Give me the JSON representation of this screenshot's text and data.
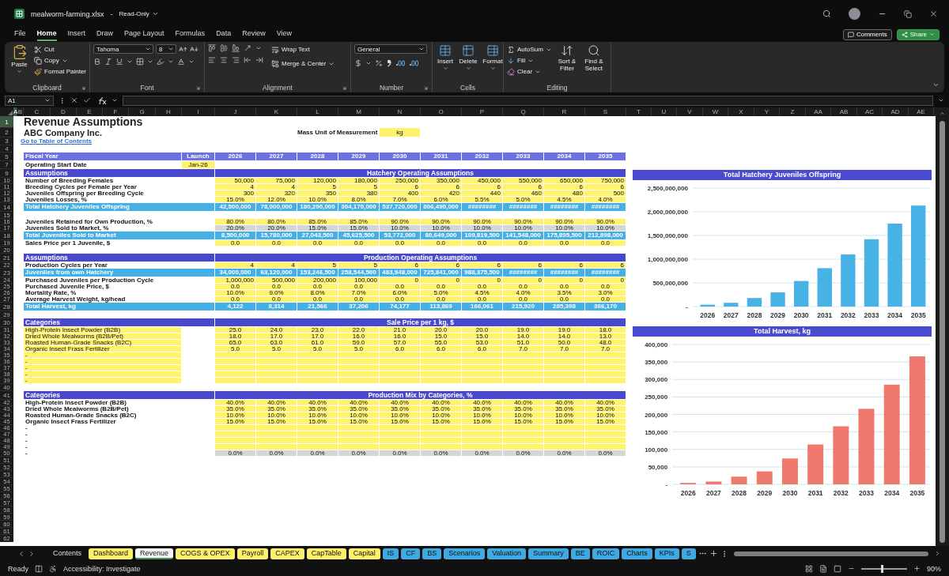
{
  "titlebar": {
    "filename": "mealworm-farming.xlsx",
    "separator": "-",
    "mode": "Read-Only"
  },
  "menu": [
    {
      "label": "File",
      "selected": false
    },
    {
      "label": "Home",
      "selected": true
    },
    {
      "label": "Insert",
      "selected": false
    },
    {
      "label": "Draw",
      "selected": false
    },
    {
      "label": "Page Layout",
      "selected": false
    },
    {
      "label": "Formulas",
      "selected": false
    },
    {
      "label": "Data",
      "selected": false
    },
    {
      "label": "Review",
      "selected": false
    },
    {
      "label": "View",
      "selected": false
    }
  ],
  "actions": {
    "comments": "Comments",
    "share": "Share"
  },
  "ribbon": {
    "clipboard": {
      "paste": "Paste",
      "cut": "Cut",
      "copy": "Copy",
      "format_painter": "Format Painter",
      "label": "Clipboard"
    },
    "font": {
      "face": "Tahoma",
      "size": "8",
      "label": "Font"
    },
    "alignment": {
      "wrap": "Wrap Text",
      "merge": "Merge & Center",
      "label": "Alignment"
    },
    "number": {
      "format": "General",
      "label": "Number"
    },
    "cells": {
      "insert": "Insert",
      "delete": "Delete",
      "format": "Format",
      "label": "Cells"
    },
    "editing": {
      "autosum": "AutoSum",
      "fill": "Fill",
      "clear": "Clear",
      "sort": "Sort & Filter",
      "find": "Find & Select",
      "label": "Editing"
    }
  },
  "formula_bar": {
    "name_box": "A1"
  },
  "columns": [
    {
      "label": "A",
      "selected": true
    },
    {
      "label": "B",
      "selected": false
    },
    {
      "label": "C",
      "selected": false
    },
    {
      "label": "D",
      "selected": false
    },
    {
      "label": "E",
      "selected": false
    },
    {
      "label": "F",
      "selected": false
    },
    {
      "label": "G",
      "selected": false
    },
    {
      "label": "H",
      "selected": false
    },
    {
      "label": "I",
      "selected": false
    },
    {
      "label": "J",
      "selected": false
    },
    {
      "label": "K",
      "selected": false
    },
    {
      "label": "L",
      "selected": false
    },
    {
      "label": "M",
      "selected": false
    },
    {
      "label": "N",
      "selected": false
    },
    {
      "label": "O",
      "selected": false
    },
    {
      "label": "P",
      "selected": false
    },
    {
      "label": "Q",
      "selected": false
    },
    {
      "label": "R",
      "selected": false
    },
    {
      "label": "S",
      "selected": false
    },
    {
      "label": "T",
      "selected": false
    },
    {
      "label": "U",
      "selected": false
    },
    {
      "label": "V",
      "selected": false
    },
    {
      "label": "W",
      "selected": false
    },
    {
      "label": "X",
      "selected": false
    },
    {
      "label": "Y",
      "selected": false
    },
    {
      "label": "Z",
      "selected": false
    },
    {
      "label": "AA",
      "selected": false
    },
    {
      "label": "AB",
      "selected": false
    },
    {
      "label": "AC",
      "selected": false
    },
    {
      "label": "AD",
      "selected": false
    },
    {
      "label": "AE",
      "selected": false
    }
  ],
  "sheet": {
    "rows": [
      {
        "n": "1",
        "kind": "title",
        "selected": true,
        "label": "Revenue Assumptions"
      },
      {
        "n": "2",
        "kind": "subtitle",
        "selected": false,
        "label": "ABC Company Inc.",
        "note": "Mass Unit of Measurement",
        "unit": "kg"
      },
      {
        "n": "3",
        "kind": "link",
        "selected": false,
        "label": "Go to Table of Contents"
      },
      {
        "n": "4",
        "kind": "blank",
        "selected": false
      },
      {
        "n": "5",
        "kind": "header",
        "selected": false,
        "label": "Fiscal Year",
        "launch": "Launch",
        "values": [
          "2026",
          "2027",
          "2028",
          "2029",
          "2030",
          "2031",
          "2032",
          "2033",
          "2034",
          "2035"
        ]
      },
      {
        "n": "7",
        "kind": "date",
        "selected": false,
        "label": "Operating Start Date",
        "launch": "Jan-26"
      },
      {
        "n": "9",
        "kind": "section",
        "selected": false,
        "label": "Assumptions",
        "title": "Hatchery Operating Assumptions"
      },
      {
        "n": "10",
        "kind": "input",
        "selected": false,
        "label": "Number of Breeding Females",
        "values": [
          "50,000",
          "75,000",
          "120,000",
          "180,000",
          "250,000",
          "350,000",
          "450,000",
          "550,000",
          "650,000",
          "750,000"
        ]
      },
      {
        "n": "11",
        "kind": "input",
        "selected": false,
        "label": "Breeding Cycles per Female per Year",
        "values": [
          "4",
          "4",
          "5",
          "5",
          "6",
          "6",
          "6",
          "6",
          "6",
          "6"
        ]
      },
      {
        "n": "12",
        "kind": "input",
        "selected": false,
        "label": "Juveniles Offspring per Breeding Cycle",
        "values": [
          "300",
          "320",
          "350",
          "380",
          "400",
          "420",
          "440",
          "460",
          "480",
          "500"
        ]
      },
      {
        "n": "13",
        "kind": "rate",
        "selected": false,
        "label": "Juveniles Losses, %",
        "values": [
          "15.0%",
          "12.0%",
          "10.0%",
          "8.0%",
          "7.0%",
          "6.0%",
          "5.5%",
          "5.0%",
          "4.5%",
          "4.0%"
        ]
      },
      {
        "n": "14",
        "kind": "total",
        "selected": false,
        "label": "Total Hatchery Juveniles Offspring",
        "values": [
          "42,500,000",
          "78,000,000",
          "180,290,000",
          "304,170,000",
          "537,720,000",
          "806,490,000",
          "########",
          "########",
          "########",
          "########"
        ]
      },
      {
        "n": "15",
        "kind": "gap",
        "selected": false
      },
      {
        "n": "16",
        "kind": "rate",
        "selected": false,
        "label": "Juveniles Retained for Own Production, %",
        "values": [
          "80.0%",
          "80.0%",
          "85.0%",
          "85.0%",
          "90.0%",
          "90.0%",
          "90.0%",
          "90.0%",
          "90.0%",
          "90.0%"
        ]
      },
      {
        "n": "17",
        "kind": "calc",
        "selected": false,
        "label": "Juveniles Sold to Market, %",
        "values": [
          "20.0%",
          "20.0%",
          "15.0%",
          "15.0%",
          "10.0%",
          "10.0%",
          "10.0%",
          "10.0%",
          "10.0%",
          "10.0%"
        ]
      },
      {
        "n": "18",
        "kind": "total",
        "selected": false,
        "label": "Total Juveniles Sold to Market",
        "values": [
          "8,500,000",
          "15,780,000",
          "27,043,500",
          "45,625,500",
          "53,772,000",
          "80,649,000",
          "109,819,500",
          "141,548,000",
          "175,895,500",
          "212,898,000"
        ]
      },
      {
        "n": "19",
        "kind": "rate",
        "selected": false,
        "label": "Sales Price per 1 Juvenile, $",
        "values": [
          "0.0",
          "0.0",
          "0.0",
          "0.0",
          "0.0",
          "0.0",
          "0.0",
          "0.0",
          "0.0",
          "0.0"
        ]
      },
      {
        "n": "20",
        "kind": "gap",
        "selected": false
      },
      {
        "n": "21",
        "kind": "section",
        "selected": false,
        "label": "Assumptions",
        "title": "Production Operating Assumptions"
      },
      {
        "n": "22",
        "kind": "input",
        "selected": false,
        "label": "Production Cycles per Year",
        "values": [
          "4",
          "4",
          "5",
          "5",
          "6",
          "6",
          "6",
          "6",
          "6",
          "6"
        ]
      },
      {
        "n": "23",
        "kind": "total",
        "selected": false,
        "label": "Juveniles from own Hatchery",
        "values": [
          "34,000,000",
          "63,120,000",
          "153,246,500",
          "258,544,500",
          "483,948,000",
          "725,841,000",
          "988,375,500",
          "########",
          "########",
          "########"
        ]
      },
      {
        "n": "24",
        "kind": "input",
        "selected": false,
        "label": "Purchased Juveniles per Production Cycle",
        "values": [
          "1,000,000",
          "500,000",
          "200,000",
          "100,000",
          "0",
          "0",
          "0",
          "0",
          "0",
          "0"
        ]
      },
      {
        "n": "25",
        "kind": "rate",
        "selected": false,
        "label": "Purchased Juvenile Price, $",
        "values": [
          "0.0",
          "0.0",
          "0.0",
          "0.0",
          "0.0",
          "0.0",
          "0.0",
          "0.0",
          "0.0",
          "0.0"
        ]
      },
      {
        "n": "26",
        "kind": "rate",
        "selected": false,
        "label": "Mortality Rate, %",
        "values": [
          "10.0%",
          "9.0%",
          "8.0%",
          "7.0%",
          "6.0%",
          "5.0%",
          "4.5%",
          "4.0%",
          "3.5%",
          "3.0%"
        ]
      },
      {
        "n": "27",
        "kind": "rate",
        "selected": false,
        "label": "Average Harvest Weight, kg/head",
        "values": [
          "0.0",
          "0.0",
          "0.0",
          "0.0",
          "0.0",
          "0.0",
          "0.0",
          "0.0",
          "0.0",
          "0.0"
        ]
      },
      {
        "n": "28",
        "kind": "total",
        "selected": false,
        "label": "Total Harvest, kg",
        "values": [
          "4,122",
          "8,314",
          "21,566",
          "37,206",
          "74,177",
          "113,869",
          "166,061",
          "215,920",
          "285,398",
          "366,170"
        ]
      },
      {
        "n": "29",
        "kind": "gap",
        "selected": false
      },
      {
        "n": "30",
        "kind": "section",
        "selected": false,
        "label": "Categories",
        "title": "Sale Price per 1 kg, $"
      },
      {
        "n": "31",
        "kind": "category",
        "selected": false,
        "label": "High-Protein Insect Powder (B2B)",
        "values": [
          "25.0",
          "24.0",
          "23.0",
          "22.0",
          "21.0",
          "20.0",
          "20.0",
          "19.0",
          "19.0",
          "18.0"
        ]
      },
      {
        "n": "32",
        "kind": "category",
        "selected": false,
        "label": "Dried Whole Mealworms (B2B/Pet)",
        "values": [
          "18.0",
          "17.0",
          "17.0",
          "16.0",
          "16.0",
          "15.0",
          "15.0",
          "14.0",
          "14.0",
          "13.0"
        ]
      },
      {
        "n": "33",
        "kind": "category",
        "selected": false,
        "label": "Roasted Human-Grade Snacks (B2C)",
        "values": [
          "65.0",
          "63.0",
          "61.0",
          "59.0",
          "57.0",
          "55.0",
          "53.0",
          "51.0",
          "50.0",
          "48.0"
        ]
      },
      {
        "n": "34",
        "kind": "category",
        "selected": false,
        "label": "Organic Insect Frass Fertilizer",
        "values": [
          "5.0",
          "5.0",
          "5.0",
          "5.0",
          "6.0",
          "6.0",
          "6.0",
          "7.0",
          "7.0",
          "7.0"
        ]
      },
      {
        "n": "35",
        "kind": "category",
        "selected": false,
        "label": "-"
      },
      {
        "n": "36",
        "kind": "category",
        "selected": false,
        "label": "-"
      },
      {
        "n": "37",
        "kind": "category",
        "selected": false,
        "label": "-"
      },
      {
        "n": "38",
        "kind": "category",
        "selected": false,
        "label": "-"
      },
      {
        "n": "39",
        "kind": "category",
        "selected": false,
        "label": "-"
      },
      {
        "n": "40",
        "kind": "blank",
        "selected": false
      },
      {
        "n": "41",
        "kind": "section",
        "selected": false,
        "label": "Categories",
        "title": "Production Mix by Categories, %"
      },
      {
        "n": "42",
        "kind": "item",
        "selected": false,
        "label": "High-Protein Insect Powder (B2B)",
        "values": [
          "40.0%",
          "40.0%",
          "40.0%",
          "40.0%",
          "40.0%",
          "40.0%",
          "40.0%",
          "40.0%",
          "40.0%",
          "40.0%"
        ]
      },
      {
        "n": "43",
        "kind": "item",
        "selected": false,
        "label": "Dried Whole Mealworms (B2B/Pet)",
        "values": [
          "35.0%",
          "35.0%",
          "35.0%",
          "35.0%",
          "35.0%",
          "35.0%",
          "35.0%",
          "35.0%",
          "35.0%",
          "35.0%"
        ]
      },
      {
        "n": "44",
        "kind": "item",
        "selected": false,
        "label": "Roasted Human-Grade Snacks (B2C)",
        "values": [
          "10.0%",
          "10.0%",
          "10.0%",
          "10.0%",
          "10.0%",
          "10.0%",
          "10.0%",
          "10.0%",
          "10.0%",
          "10.0%"
        ]
      },
      {
        "n": "45",
        "kind": "item",
        "selected": false,
        "label": "Organic Insect Frass Fertilizer",
        "values": [
          "15.0%",
          "15.0%",
          "15.0%",
          "15.0%",
          "15.0%",
          "15.0%",
          "15.0%",
          "15.0%",
          "15.0%",
          "15.0%"
        ]
      },
      {
        "n": "46",
        "kind": "item",
        "selected": false,
        "label": "-"
      },
      {
        "n": "47",
        "kind": "item",
        "selected": false,
        "label": "-"
      },
      {
        "n": "48",
        "kind": "item",
        "selected": false,
        "label": "-"
      },
      {
        "n": "49",
        "kind": "item",
        "selected": false,
        "label": "-"
      },
      {
        "n": "50",
        "kind": "calc",
        "selected": false,
        "label": "-",
        "values": [
          "0.0%",
          "0.0%",
          "0.0%",
          "0.0%",
          "0.0%",
          "0.0%",
          "0.0%",
          "0.0%",
          "0.0%",
          "0.0%"
        ]
      },
      {
        "n": "51",
        "kind": "blank",
        "selected": false
      },
      {
        "n": "52",
        "kind": "blank",
        "selected": false
      },
      {
        "n": "53",
        "kind": "blank",
        "selected": false
      },
      {
        "n": "54",
        "kind": "blank",
        "selected": false
      },
      {
        "n": "55",
        "kind": "blank",
        "selected": false
      },
      {
        "n": "56",
        "kind": "blank",
        "selected": false
      },
      {
        "n": "57",
        "kind": "blank",
        "selected": false
      },
      {
        "n": "58",
        "kind": "blank",
        "selected": false
      },
      {
        "n": "59",
        "kind": "blank",
        "selected": false
      },
      {
        "n": "60",
        "kind": "blank",
        "selected": false
      },
      {
        "n": "61",
        "kind": "blank",
        "selected": false
      },
      {
        "n": "62",
        "kind": "blank",
        "selected": false
      }
    ]
  },
  "charts": [
    {
      "chart_data": {
        "type": "bar",
        "title": "Total Hatchery Juveniles Offspring",
        "categories": [
          "2026",
          "2027",
          "2028",
          "2029",
          "2030",
          "2031",
          "2032",
          "2033",
          "2034",
          "2035"
        ],
        "series": [
          {
            "color": "#47b2e6",
            "values": [
              40000000,
              80000000,
              180000000,
              300000000,
              540000000,
              810000000,
              1100000000,
              1420000000,
              1750000000,
              2130000000
            ]
          }
        ],
        "ylim": [
          0,
          2500000000
        ],
        "grid": true,
        "yticks": [
          {
            "value": 0,
            "label": "-"
          },
          {
            "value": 500000000,
            "label": "500,000,000"
          },
          {
            "value": 1000000000,
            "label": "1,000,000,000"
          },
          {
            "value": 1500000000,
            "label": "1,500,000,000"
          },
          {
            "value": 2000000000,
            "label": "2,000,000,000"
          },
          {
            "value": 2500000000,
            "label": "2,500,000,000"
          }
        ]
      }
    },
    {
      "chart_data": {
        "type": "bar",
        "title": "Total Harvest, kg",
        "categories": [
          "2026",
          "2027",
          "2028",
          "2029",
          "2030",
          "2031",
          "2032",
          "2033",
          "2034",
          "2035"
        ],
        "series": [
          {
            "color": "#f0786c",
            "values": [
              4000,
              8000,
              22000,
              37000,
              74000,
              114000,
              166000,
              216000,
              285000,
              366000
            ]
          }
        ],
        "ylim": [
          0,
          400000
        ],
        "grid": true,
        "yticks": [
          {
            "value": 0,
            "label": "-"
          },
          {
            "value": 50000,
            "label": "50,000"
          },
          {
            "value": 100000,
            "label": "100,000"
          },
          {
            "value": 150000,
            "label": "150,000"
          },
          {
            "value": 200000,
            "label": "200,000"
          },
          {
            "value": 250000,
            "label": "250,000"
          },
          {
            "value": 300000,
            "label": "300,000"
          },
          {
            "value": 350000,
            "label": "350,000"
          },
          {
            "value": 400000,
            "label": "400,000"
          }
        ]
      }
    }
  ],
  "sheet_tabs": [
    {
      "label": "Contents",
      "selected": false
    },
    {
      "label": "Dashboard",
      "color": "#fff06b",
      "selected": false
    },
    {
      "label": "Revenue",
      "selected": true
    },
    {
      "label": "COGS & OPEX",
      "color": "#fff06b",
      "selected": false
    },
    {
      "label": "Payroll",
      "color": "#fff06b",
      "selected": false
    },
    {
      "label": "CAPEX",
      "color": "#fff06b",
      "selected": false
    },
    {
      "label": "CapTable",
      "color": "#fff06b",
      "selected": false
    },
    {
      "label": "Capital",
      "color": "#fff06b",
      "selected": false
    },
    {
      "label": "IS",
      "color": "#3fa9e1",
      "selected": false
    },
    {
      "label": "CF",
      "color": "#3fa9e1",
      "selected": false
    },
    {
      "label": "BS",
      "color": "#3fa9e1",
      "selected": false
    },
    {
      "label": "Scenarios",
      "color": "#3fa9e1",
      "selected": false
    },
    {
      "label": "Valuation",
      "color": "#3fa9e1",
      "selected": false
    },
    {
      "label": "Summary",
      "color": "#3fa9e1",
      "selected": false
    },
    {
      "label": "BE",
      "color": "#3fa9e1",
      "selected": false
    },
    {
      "label": "ROIC",
      "color": "#3fa9e1",
      "selected": false
    },
    {
      "label": "Charts",
      "color": "#3fa9e1",
      "selected": false
    },
    {
      "label": "KPIs",
      "color": "#3fa9e1",
      "selected": false
    },
    {
      "label": "S",
      "color": "#3fa9e1",
      "selected": false
    }
  ],
  "status": {
    "ready": "Ready",
    "accessibility": "Accessibility: Investigate",
    "zoom": {
      "level": 0.45,
      "reading": "90%"
    }
  }
}
